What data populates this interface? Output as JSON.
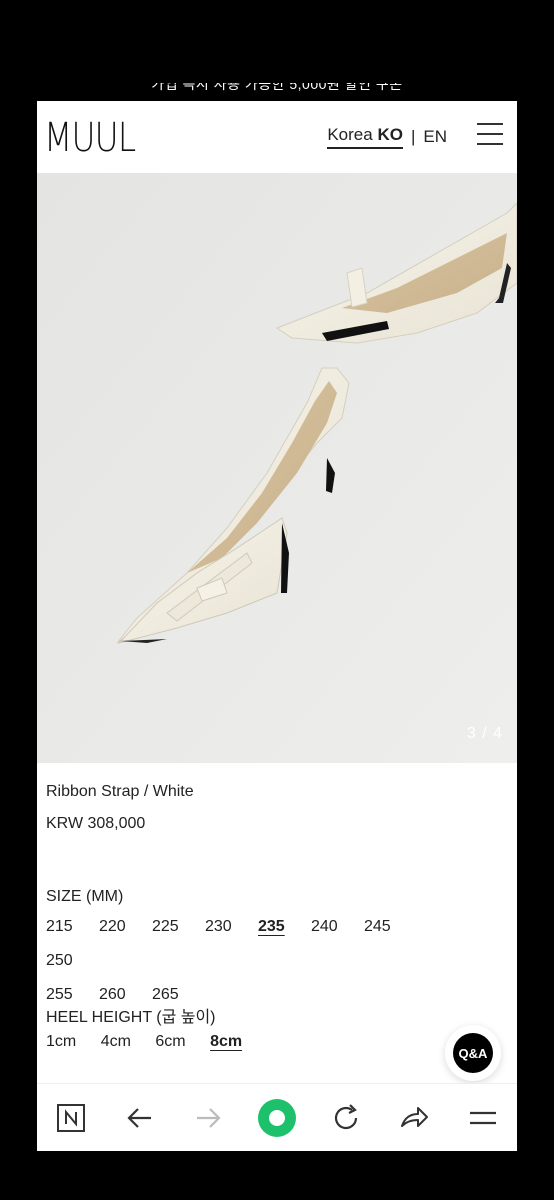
{
  "promo": {
    "text": "가입 즉시 사용 가능한 5,000원 할인 쿠폰"
  },
  "header": {
    "logo": "MUUL",
    "lang_korea": "Korea",
    "lang_ko": "KO",
    "lang_sep": "|",
    "lang_en": "EN"
  },
  "gallery": {
    "counter": "3 / 4"
  },
  "product": {
    "name": "Ribbon Strap / White",
    "price": "KRW 308,000"
  },
  "size": {
    "title": "SIZE (MM)",
    "options": [
      "215",
      "220",
      "225",
      "230",
      "235",
      "240",
      "245",
      "250",
      "255",
      "260",
      "265"
    ],
    "selected": "235"
  },
  "heel": {
    "title": "HEEL HEIGHT (굽 높이)",
    "options": [
      "1cm",
      "4cm",
      "6cm",
      "8cm"
    ],
    "selected": "8cm"
  },
  "qa_button": {
    "label": "Q&A"
  },
  "colors": {
    "accent_green": "#1ec16b",
    "background": "#ffffff",
    "frame": "#000000"
  }
}
